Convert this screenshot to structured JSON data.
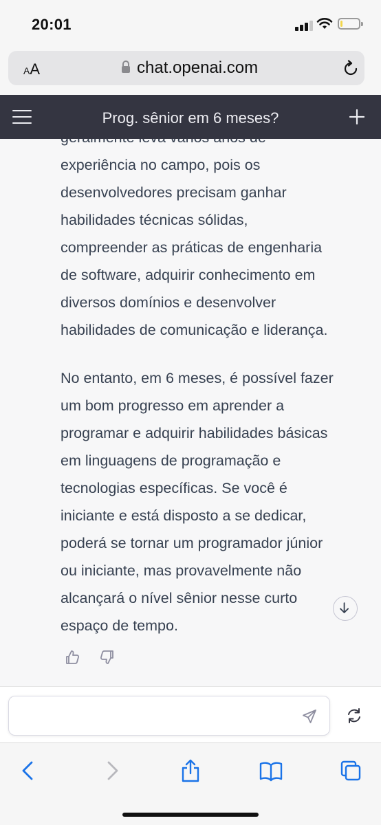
{
  "status_bar": {
    "time": "20:01"
  },
  "browser": {
    "text_size_label_small": "A",
    "text_size_label_large": "A",
    "url": "chat.openai.com"
  },
  "chat": {
    "title": "Prog. sênior em 6 meses?",
    "paragraph_1_lines": [
      "geralmente leva vários anos de",
      "experiência no campo, pois os",
      "desenvolvedores precisam ganhar",
      "habilidades técnicas sólidas,",
      "compreender as práticas de engenharia",
      "de software, adquirir conhecimento em",
      "diversos domínios e desenvolver",
      "habilidades de comunicação e liderança."
    ],
    "paragraph_2_lines": [
      "No entanto, em 6 meses, é possível fazer",
      "um bom progresso em aprender a",
      "programar e adquirir habilidades básicas",
      "em linguagens de programação e",
      "tecnologias específicas. Se você é",
      "iniciante e está disposto a se dedicar,",
      "poderá se tornar um programador júnior",
      "ou iniciante, mas provavelmente não",
      "alcançará o nível sênior nesse curto",
      "espaço de tempo."
    ]
  },
  "input": {
    "placeholder": ""
  },
  "colors": {
    "header_bg": "#343541",
    "header_text": "#ececf1",
    "body_text": "#374151",
    "content_bg": "#f7f7f8",
    "ios_blue": "#1a73e8",
    "battery": "#f2d64b"
  },
  "icons": [
    "menu-icon",
    "plus-icon",
    "lock-icon",
    "reload-icon",
    "thumbs-up-icon",
    "thumbs-down-icon",
    "arrow-down-icon",
    "send-icon",
    "regenerate-icon",
    "back-icon",
    "forward-icon",
    "share-icon",
    "bookmarks-icon",
    "tabs-icon"
  ],
  "status": {
    "battery_level": 0.1
  }
}
